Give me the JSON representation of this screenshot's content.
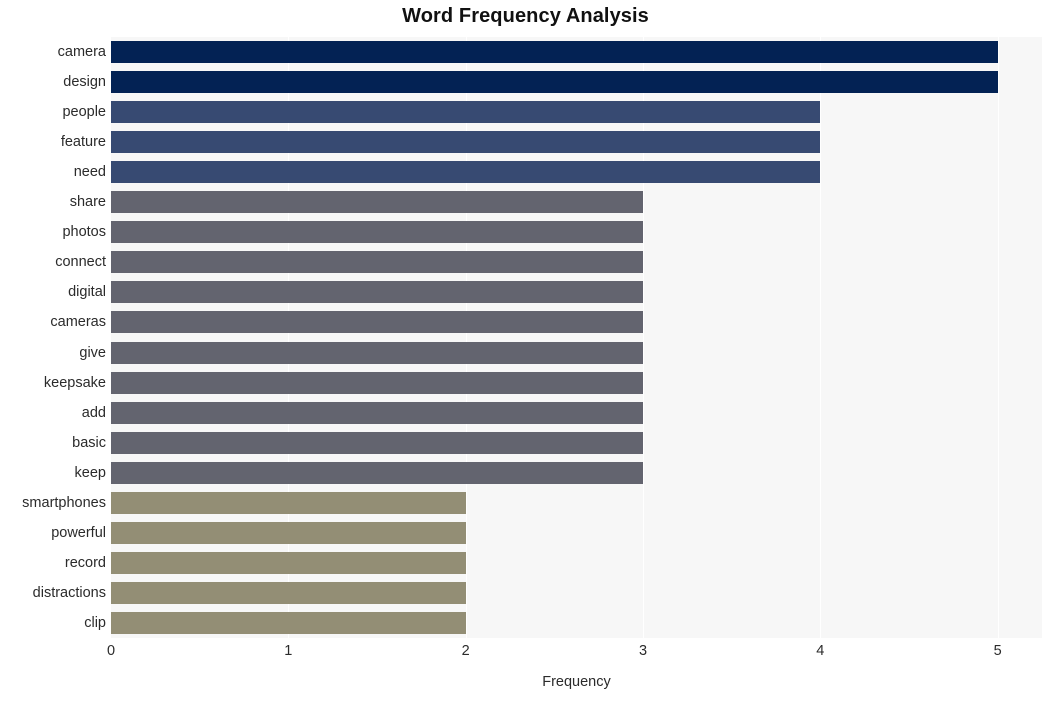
{
  "chart_data": {
    "type": "bar",
    "orientation": "horizontal",
    "title": "Word Frequency Analysis",
    "xlabel": "Frequency",
    "ylabel": "",
    "xlim": [
      0,
      5.25
    ],
    "xticks": [
      "0",
      "1",
      "2",
      "3",
      "4",
      "5"
    ],
    "xtick_values": [
      0,
      1,
      2,
      3,
      4,
      5
    ],
    "grid": "vertical-white-on-light-gray",
    "legend": "none",
    "categories": [
      "camera",
      "design",
      "people",
      "feature",
      "need",
      "share",
      "photos",
      "connect",
      "digital",
      "cameras",
      "give",
      "keepsake",
      "add",
      "basic",
      "keep",
      "smartphones",
      "powerful",
      "record",
      "distractions",
      "clip"
    ],
    "values": [
      5,
      5,
      4,
      4,
      4,
      3,
      3,
      3,
      3,
      3,
      3,
      3,
      3,
      3,
      3,
      2,
      2,
      2,
      2,
      2
    ],
    "bar_colors": [
      "#032254",
      "#032254",
      "#374a72",
      "#374a72",
      "#374a72",
      "#63646f",
      "#63646f",
      "#63646f",
      "#63646f",
      "#63646f",
      "#63646f",
      "#63646f",
      "#63646f",
      "#63646f",
      "#63646f",
      "#938e75",
      "#938e75",
      "#938e75",
      "#938e75",
      "#938e75"
    ],
    "palette": {
      "value_5": "#032254",
      "value_4": "#374a72",
      "value_3": "#63646f",
      "value_2": "#938e75",
      "plot_background": "#f7f7f7",
      "gridline": "#ffffff",
      "figure_background": "#ffffff",
      "text": "#2b2b2b"
    }
  }
}
